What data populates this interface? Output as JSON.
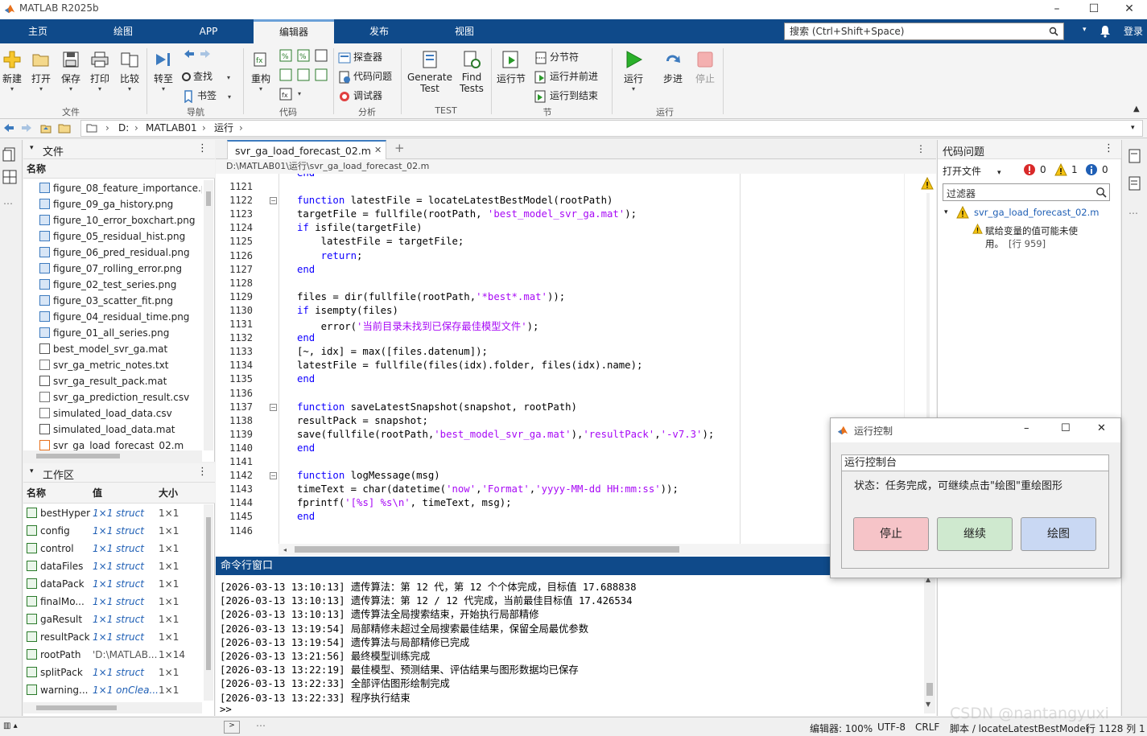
{
  "window": {
    "title": "MATLAB R2025b"
  },
  "ribbon_tabs": [
    "主页",
    "绘图",
    "APP",
    "编辑器",
    "发布",
    "视图"
  ],
  "search": {
    "placeholder": "搜索 (Ctrl+Shift+Space)"
  },
  "login_label": "登录",
  "ribbon": {
    "file": {
      "new": "新建",
      "open": "打开",
      "save": "保存",
      "print": "打印",
      "compare": "比较",
      "group": "文件"
    },
    "nav": {
      "goto": "转至",
      "find": "查找",
      "bookmark": "书签",
      "group": "导航"
    },
    "code": {
      "refactor": "重构",
      "group": "代码"
    },
    "analyze": {
      "explorer": "探查器",
      "issues": "代码问题",
      "debugger": "调试器",
      "group": "分析"
    },
    "test": {
      "gen1": "Generate",
      "gen2": "Test",
      "find1": "Find",
      "find2": "Tests",
      "group": "TEST"
    },
    "section": {
      "run_section": "运行节",
      "section_break": "分节符",
      "run_advance": "运行并前进",
      "run_end": "运行到结束",
      "group": "节"
    },
    "run": {
      "run": "运行",
      "step": "步进",
      "stop": "停止",
      "group": "运行"
    }
  },
  "address": {
    "drive": "D:",
    "folder": "MATLAB01",
    "sub": "运行"
  },
  "files_panel": {
    "title": "文件",
    "col_name": "名称",
    "items": [
      {
        "name": "figure_08_feature_importance.png",
        "type": "img"
      },
      {
        "name": "figure_09_ga_history.png",
        "type": "img"
      },
      {
        "name": "figure_10_error_boxchart.png",
        "type": "img"
      },
      {
        "name": "figure_05_residual_hist.png",
        "type": "img"
      },
      {
        "name": "figure_06_pred_residual.png",
        "type": "img"
      },
      {
        "name": "figure_07_rolling_error.png",
        "type": "img"
      },
      {
        "name": "figure_02_test_series.png",
        "type": "img"
      },
      {
        "name": "figure_03_scatter_fit.png",
        "type": "img"
      },
      {
        "name": "figure_04_residual_time.png",
        "type": "img"
      },
      {
        "name": "figure_01_all_series.png",
        "type": "img"
      },
      {
        "name": "best_model_svr_ga.mat",
        "type": "mat"
      },
      {
        "name": "svr_ga_metric_notes.txt",
        "type": "txt"
      },
      {
        "name": "svr_ga_result_pack.mat",
        "type": "mat"
      },
      {
        "name": "svr_ga_prediction_result.csv",
        "type": "txt"
      },
      {
        "name": "simulated_load_data.csv",
        "type": "txt"
      },
      {
        "name": "simulated_load_data.mat",
        "type": "mat"
      },
      {
        "name": "svr_ga_load_forecast_02.m",
        "type": "m"
      }
    ]
  },
  "workspace_panel": {
    "title": "工作区",
    "cols": [
      "名称",
      "值",
      "大小"
    ],
    "items": [
      {
        "name": "bestHyper",
        "value": "1×1 struct",
        "size": "1×1"
      },
      {
        "name": "config",
        "value": "1×1 struct",
        "size": "1×1"
      },
      {
        "name": "control",
        "value": "1×1 struct",
        "size": "1×1"
      },
      {
        "name": "dataFiles",
        "value": "1×1 struct",
        "size": "1×1"
      },
      {
        "name": "dataPack",
        "value": "1×1 struct",
        "size": "1×1"
      },
      {
        "name": "finalMo...",
        "value": "1×1 struct",
        "size": "1×1"
      },
      {
        "name": "gaResult",
        "value": "1×1 struct",
        "size": "1×1"
      },
      {
        "name": "resultPack",
        "value": "1×1 struct",
        "size": "1×1"
      },
      {
        "name": "rootPath",
        "value": "'D:\\MATLAB...",
        "size": "1×14"
      },
      {
        "name": "splitPack",
        "value": "1×1 struct",
        "size": "1×1"
      },
      {
        "name": "warning...",
        "value": "1×1 onClea...",
        "size": "1×1"
      }
    ]
  },
  "editor": {
    "tab": "svr_ga_load_forecast_02.m",
    "path": "D:\\MATLAB01\\运行\\svr_ga_load_forecast_02.m",
    "first_line_partial": "end",
    "lines": [
      {
        "n": "1121",
        "segs": [
          {
            "t": ""
          }
        ]
      },
      {
        "n": "1122",
        "fold": true,
        "segs": [
          {
            "t": "function",
            "c": "kw"
          },
          {
            "t": " latestFile = locateLatestBestModel(rootPath)"
          }
        ]
      },
      {
        "n": "1123",
        "segs": [
          {
            "t": "targetFile = fullfile(rootPath, "
          },
          {
            "t": "'best_model_svr_ga.mat'",
            "c": "str"
          },
          {
            "t": ");"
          }
        ]
      },
      {
        "n": "1124",
        "segs": [
          {
            "t": "if",
            "c": "kw"
          },
          {
            "t": " isfile(targetFile)"
          }
        ]
      },
      {
        "n": "1125",
        "segs": [
          {
            "t": "    latestFile = targetFile;"
          }
        ]
      },
      {
        "n": "1126",
        "segs": [
          {
            "t": "    "
          },
          {
            "t": "return",
            "c": "kw"
          },
          {
            "t": ";"
          }
        ]
      },
      {
        "n": "1127",
        "segs": [
          {
            "t": "end",
            "c": "kw"
          }
        ]
      },
      {
        "n": "1128",
        "segs": [
          {
            "t": ""
          }
        ]
      },
      {
        "n": "1129",
        "segs": [
          {
            "t": "files = dir(fullfile(rootPath,"
          },
          {
            "t": "'*best*.mat'",
            "c": "str"
          },
          {
            "t": "));"
          }
        ]
      },
      {
        "n": "1130",
        "segs": [
          {
            "t": "if",
            "c": "kw"
          },
          {
            "t": " isempty(files)"
          }
        ]
      },
      {
        "n": "1131",
        "segs": [
          {
            "t": "    error("
          },
          {
            "t": "'当前目录未找到已保存最佳模型文件'",
            "c": "str"
          },
          {
            "t": ");"
          }
        ]
      },
      {
        "n": "1132",
        "segs": [
          {
            "t": "end",
            "c": "kw"
          }
        ]
      },
      {
        "n": "1133",
        "segs": [
          {
            "t": "[~, idx] = max([files.datenum]);"
          }
        ]
      },
      {
        "n": "1134",
        "segs": [
          {
            "t": "latestFile = fullfile(files(idx).folder, files(idx).name);"
          }
        ]
      },
      {
        "n": "1135",
        "segs": [
          {
            "t": "end",
            "c": "kw"
          }
        ]
      },
      {
        "n": "1136",
        "segs": [
          {
            "t": ""
          }
        ]
      },
      {
        "n": "1137",
        "fold": true,
        "segs": [
          {
            "t": "function",
            "c": "kw"
          },
          {
            "t": " saveLatestSnapshot(snapshot, rootPath)"
          }
        ]
      },
      {
        "n": "1138",
        "segs": [
          {
            "t": "resultPack = snapshot;"
          }
        ]
      },
      {
        "n": "1139",
        "segs": [
          {
            "t": "save(fullfile(rootPath,"
          },
          {
            "t": "'best_model_svr_ga.mat'",
            "c": "str"
          },
          {
            "t": "),"
          },
          {
            "t": "'resultPack'",
            "c": "str"
          },
          {
            "t": ","
          },
          {
            "t": "'-v7.3'",
            "c": "str"
          },
          {
            "t": ");"
          }
        ]
      },
      {
        "n": "1140",
        "segs": [
          {
            "t": "end",
            "c": "kw"
          }
        ]
      },
      {
        "n": "1141",
        "segs": [
          {
            "t": ""
          }
        ]
      },
      {
        "n": "1142",
        "fold": true,
        "segs": [
          {
            "t": "function",
            "c": "kw"
          },
          {
            "t": " logMessage(msg)"
          }
        ]
      },
      {
        "n": "1143",
        "segs": [
          {
            "t": "timeText = char(datetime("
          },
          {
            "t": "'now'",
            "c": "str"
          },
          {
            "t": ","
          },
          {
            "t": "'Format'",
            "c": "str"
          },
          {
            "t": ","
          },
          {
            "t": "'yyyy-MM-dd HH:mm:ss'",
            "c": "str"
          },
          {
            "t": "));"
          }
        ]
      },
      {
        "n": "1144",
        "segs": [
          {
            "t": "fprintf("
          },
          {
            "t": "'[%s] %s\\n'",
            "c": "str"
          },
          {
            "t": ", timeText, msg);"
          }
        ]
      },
      {
        "n": "1145",
        "segs": [
          {
            "t": "end",
            "c": "kw"
          }
        ]
      },
      {
        "n": "1146",
        "segs": [
          {
            "t": ""
          }
        ]
      }
    ]
  },
  "issues_panel": {
    "title": "代码问题",
    "open_files": "打开文件",
    "errors": "0",
    "warnings": "1",
    "infos": "0",
    "filter_placeholder": "过滤器",
    "file": "svr_ga_load_forecast_02.m",
    "message_1": "赋给变量的值可能未使",
    "message_2": "用。",
    "message_line": "[行 959]"
  },
  "command_window": {
    "title": "命令行窗口",
    "lines": [
      "[2026-03-13 13:10:13] 遗传算法：第 12 代，第 12 个个体完成，目标值 17.688838",
      "[2026-03-13 13:10:13] 遗传算法：第 12 / 12 代完成，当前最佳目标值 17.426534",
      "[2026-03-13 13:10:13] 遗传算法全局搜索结束，开始执行局部精修",
      "[2026-03-13 13:19:54] 局部精修未超过全局搜索最佳结果，保留全局最优参数",
      "[2026-03-13 13:19:54] 遗传算法与局部精修已完成",
      "[2026-03-13 13:21:56] 最终模型训练完成",
      "[2026-03-13 13:22:19] 最佳模型、预测结果、评估结果与图形数据均已保存",
      "[2026-03-13 13:22:33] 全部评估图形绘制完成",
      "[2026-03-13 13:22:33] 程序执行结束"
    ],
    "prompt": ">>"
  },
  "status_bar": {
    "zoom": "编辑器: 100%",
    "encoding": "UTF-8",
    "eol": "CRLF",
    "context": "脚本 / locateLatestBestModel",
    "position": "行 1128  列 1"
  },
  "watermark": "CSDN @nantangyuxi",
  "dialog": {
    "title": "运行控制",
    "group": "运行控制台",
    "status": "状态：任务完成，可继续点击\"绘图\"重绘图形",
    "btn_stop": "停止",
    "btn_continue": "继续",
    "btn_plot": "绘图",
    "colors": {
      "stop": "#f6c4c8",
      "continue": "#cfe9cf",
      "plot": "#c9d8f3"
    }
  }
}
